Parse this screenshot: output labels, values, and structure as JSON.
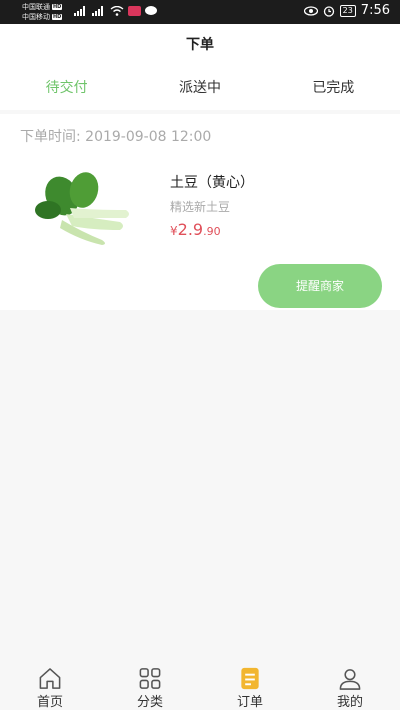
{
  "status_bar": {
    "carrier_1": "中国联通",
    "carrier_2": "中国移动",
    "hd_badge": "HD",
    "battery": "23",
    "time": "7:56",
    "icons": [
      "signal-icon",
      "wifi-icon",
      "app-icon",
      "chat-icon",
      "eye-icon",
      "alarm-icon",
      "battery-icon"
    ]
  },
  "header": {
    "title": "下单"
  },
  "tabs": [
    {
      "label": "待交付",
      "active": true
    },
    {
      "label": "派送中",
      "active": false
    },
    {
      "label": "已完成",
      "active": false
    }
  ],
  "order": {
    "time": "下单时间: 2019-09-08 12:00",
    "product": {
      "name": "土豆（黄心）",
      "description": "精选新土豆",
      "price_symbol": "¥",
      "price_main": "2.9",
      "price_cents": ".90"
    },
    "remind_button": "提醒商家"
  },
  "bottom_nav": [
    {
      "label": "首页",
      "icon": "home-icon"
    },
    {
      "label": "分类",
      "icon": "category-icon"
    },
    {
      "label": "订单",
      "icon": "order-icon",
      "active": true
    },
    {
      "label": "我的",
      "icon": "profile-icon"
    }
  ],
  "colors": {
    "accent": "#6fc46a",
    "button": "#8ad483",
    "price": "#e0505a",
    "order_icon": "#f2b630"
  }
}
